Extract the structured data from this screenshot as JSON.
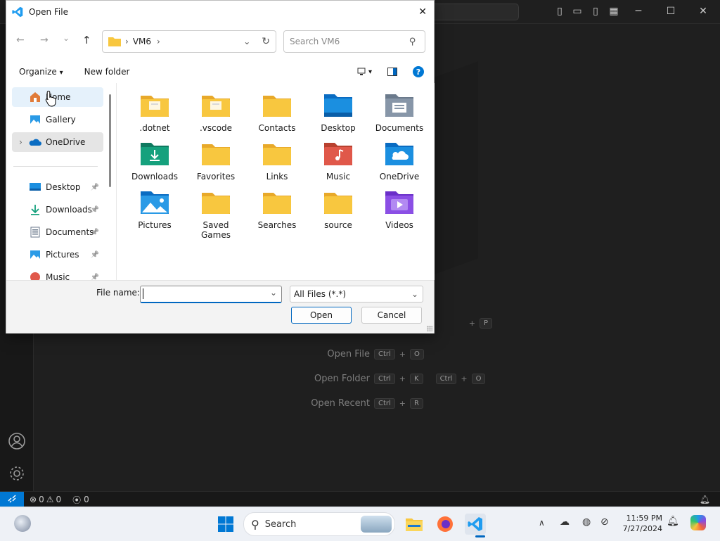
{
  "dialog": {
    "title": "Open File",
    "close_glyph": "✕",
    "nav_back": "←",
    "nav_forward": "→",
    "nav_recent": "⌄",
    "nav_up": "↑",
    "address_path": [
      "VM6"
    ],
    "address_sep": "›",
    "address_dropdown": "⌄",
    "address_refresh": "↻",
    "search_placeholder": "Search VM6",
    "search_glyph": "⚲",
    "organize_label": "Organize",
    "new_folder_label": "New folder",
    "caret": "▾",
    "nav_expander": "›",
    "pin_glyph": "📌",
    "nav_items": [
      {
        "label": "Home",
        "icon": "home-icon",
        "selected": true
      },
      {
        "label": "Gallery",
        "icon": "gallery-icon"
      },
      {
        "label": "OneDrive",
        "icon": "onedrive-icon",
        "expandable": true,
        "hover": true
      }
    ],
    "quick_access": [
      {
        "label": "Desktop",
        "icon": "desktop-icon"
      },
      {
        "label": "Downloads",
        "icon": "downloads-icon"
      },
      {
        "label": "Documents",
        "icon": "documents-icon"
      },
      {
        "label": "Pictures",
        "icon": "pictures-icon"
      },
      {
        "label": "Music",
        "icon": "music-icon"
      }
    ],
    "folders": [
      {
        "label": ".dotnet",
        "kind": "doc"
      },
      {
        "label": ".vscode",
        "kind": "doc"
      },
      {
        "label": "Contacts",
        "kind": "plain"
      },
      {
        "label": "Desktop",
        "kind": "desktop"
      },
      {
        "label": "Documents",
        "kind": "documents"
      },
      {
        "label": "Downloads",
        "kind": "downloads"
      },
      {
        "label": "Favorites",
        "kind": "plain"
      },
      {
        "label": "Links",
        "kind": "plain"
      },
      {
        "label": "Music",
        "kind": "music"
      },
      {
        "label": "OneDrive",
        "kind": "onedrive"
      },
      {
        "label": "Pictures",
        "kind": "pictures"
      },
      {
        "label": "Saved Games",
        "kind": "plain"
      },
      {
        "label": "Searches",
        "kind": "plain"
      },
      {
        "label": "source",
        "kind": "plain"
      },
      {
        "label": "Videos",
        "kind": "videos"
      }
    ],
    "file_name_label": "File name:",
    "file_name_value": "",
    "dropdown_glyph": "⌄",
    "filter_value": "All Files (*.*)",
    "open_label": "Open",
    "cancel_label": "Cancel",
    "colors": {
      "accent": "#0067c0",
      "folder": "#f8c73f",
      "folder_dark": "#e8a92a"
    }
  },
  "vscode": {
    "shortcuts": [
      {
        "label": "Open File",
        "keys": [
          [
            "Ctrl",
            "O"
          ]
        ]
      },
      {
        "label": "Open Folder",
        "keys": [
          [
            "Ctrl",
            "K"
          ],
          [
            "Ctrl",
            "O"
          ]
        ]
      },
      {
        "label": "Open Recent",
        "keys": [
          [
            "Ctrl",
            "R"
          ]
        ]
      }
    ],
    "partial_shortcut_key": "P",
    "plus": "+",
    "status": {
      "errors": "0",
      "warnings": "0",
      "ports": "0"
    }
  },
  "taskbar": {
    "search_label": "Search",
    "time": "11:59 PM",
    "date": "7/27/2024",
    "chevron": "∧"
  }
}
